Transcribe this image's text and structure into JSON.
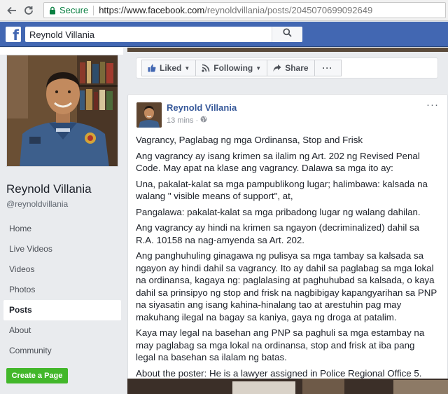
{
  "browser": {
    "secure_label": "Secure",
    "url_host": "https://www.facebook.com",
    "url_path": "/reynoldvillania/posts/2045070699092649"
  },
  "fb": {
    "logo": "f",
    "search_value": "Reynold Villania"
  },
  "page": {
    "name": "Reynold Villania",
    "handle": "@reynoldvillania",
    "nav": [
      "Home",
      "Live Videos",
      "Videos",
      "Photos",
      "Posts",
      "About",
      "Community"
    ],
    "active_nav": "Posts",
    "create_button": "Create a Page"
  },
  "actions": {
    "liked": "Liked",
    "following": "Following",
    "share": "Share",
    "more": "···"
  },
  "post": {
    "author": "Reynold Villania",
    "time": "13 mins",
    "more": "···",
    "paragraphs": [
      "Vagrancy, Paglabag ng mga Ordinansa, Stop and Frisk",
      "Ang vagrancy ay isang krimen sa ilalim ng Art. 202 ng Revised Penal Code. May apat na klase ang vagrancy. Dalawa sa mga ito ay:",
      "Una, pakalat-kalat sa mga pampublikong lugar; halimbawa: kalsada na walang \" visible means of support\", at,",
      "Pangalawa: pakalat-kalat sa mga pribadong lugar ng walang dahilan.",
      "Ang vagrancy ay hindi na krimen sa ngayon (decriminalized) dahil sa R.A. 10158 na nag-amyenda sa Art. 202.",
      "Ang panghuhuling ginagawa ng pulisya sa mga tambay sa kalsada sa ngayon ay hindi dahil sa vagrancy. Ito ay dahil sa paglabag sa mga lokal na ordinansa, kagaya ng: paglalasing at paghuhubad sa kalsada, o kaya dahil sa prinsipyo ng stop and frisk na nagbibigay kapangyarihan sa PNP na siyasatin ang isang kahina-hinalang tao at arestuhin pag may makuhang ilegal na bagay sa kaniya, gaya ng droga at patalim.",
      "Kaya may legal na basehan ang PNP sa paghuli sa mga estambay na may paglabag sa mga lokal na ordinansa, stop and frisk at iba pang legal na basehan sa ilalam ng batas.",
      "About the poster: He is a lawyer assigned in Police Regional Office 5."
    ]
  },
  "colors": {
    "fb_blue": "#4267b2",
    "link_blue": "#365899",
    "create_green": "#42b72a",
    "secure_green": "#0b8043"
  },
  "icons": [
    "back-arrow-icon",
    "reload-icon",
    "lock-icon",
    "search-icon",
    "thumbs-up-icon",
    "rss-icon",
    "share-arrow-icon",
    "globe-icon"
  ]
}
